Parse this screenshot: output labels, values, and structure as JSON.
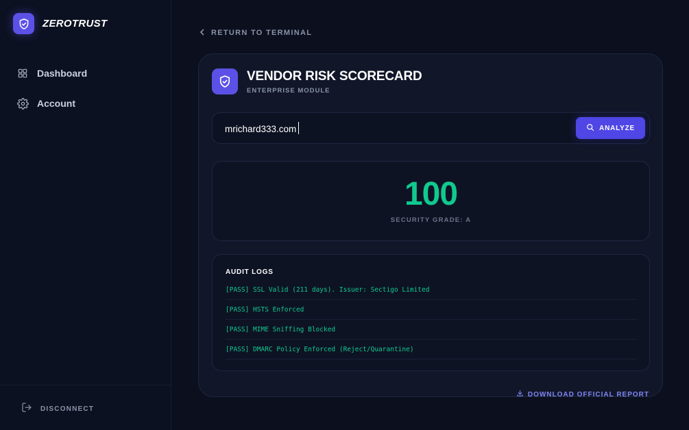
{
  "brand": {
    "name": "ZEROTRUST",
    "accent": "#5b51e6"
  },
  "sidebar": {
    "items": [
      {
        "label": "Dashboard",
        "icon": "grid-icon"
      },
      {
        "label": "Account",
        "icon": "gear-icon"
      }
    ],
    "footer": {
      "label": "DISCONNECT",
      "icon": "logout-icon"
    }
  },
  "main": {
    "return_label": "RETURN TO TERMINAL",
    "card": {
      "title": "VENDOR RISK SCORECARD",
      "subtitle": "ENTERPRISE MODULE",
      "search": {
        "value": "mrichard333.com",
        "placeholder": ""
      },
      "analyze_label": "ANALYZE",
      "score": {
        "value": "100",
        "grade_label": "SECURITY GRADE: A",
        "color": "#10c98f"
      },
      "audit": {
        "title": "AUDIT LOGS",
        "entries": [
          "[PASS] SSL Valid (211 days). Issuer: Sectigo Limited",
          "[PASS] HSTS Enforced",
          "[PASS] MIME Sniffing Blocked",
          "[PASS] DMARC Policy Enforced (Reject/Quarantine)"
        ]
      },
      "download_label": "DOWNLOAD OFFICIAL REPORT"
    }
  }
}
